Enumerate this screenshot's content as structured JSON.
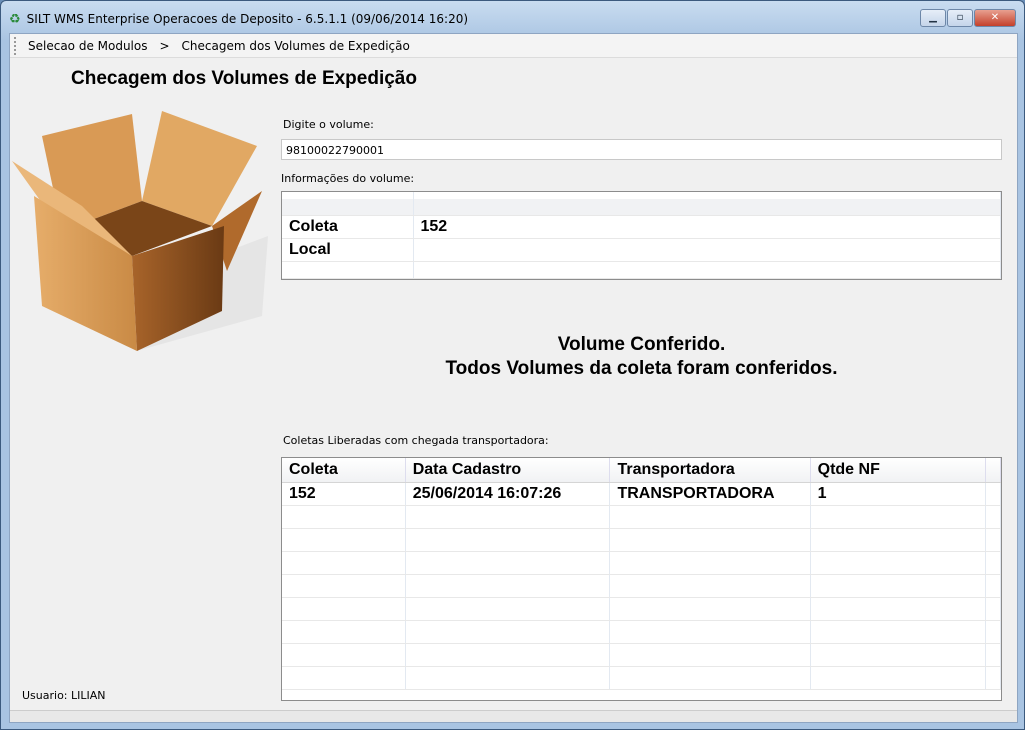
{
  "window": {
    "title": "SILT WMS Enterprise Operacoes de Deposito - 6.5.1.1 (09/06/2014 16:20)"
  },
  "breadcrumb": {
    "items": [
      "Selecao de Modulos",
      "Checagem dos Volumes de Expedição"
    ],
    "separator": ">"
  },
  "page": {
    "title": "Checagem dos Volumes de Expedição"
  },
  "volume": {
    "label": "Digite o volume:",
    "value": "98100022790001"
  },
  "info": {
    "label": "Informações do volume:",
    "rows": [
      {
        "k": "Coleta",
        "v": "152"
      },
      {
        "k": "Local",
        "v": ""
      }
    ]
  },
  "message": {
    "line1": "Volume Conferido.",
    "line2": "Todos Volumes da coleta foram conferidos."
  },
  "coletas": {
    "label": "Coletas Liberadas com chegada transportadora:",
    "columns": [
      "Coleta",
      "Data Cadastro",
      "Transportadora",
      "Qtde NF"
    ],
    "rows": [
      [
        "152",
        "25/06/2014 16:07:26",
        "TRANSPORTADORA",
        "1"
      ]
    ]
  },
  "status": {
    "user": "Usuario: LILIAN"
  }
}
